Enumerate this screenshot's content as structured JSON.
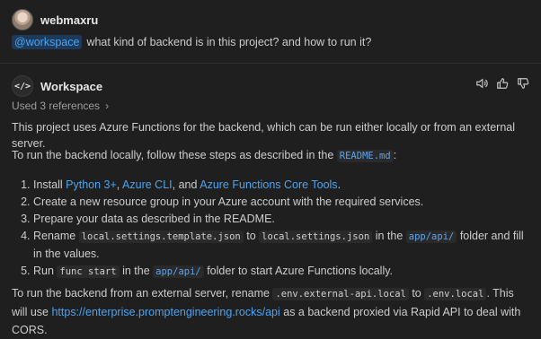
{
  "user": {
    "name": "webmaxru"
  },
  "question": {
    "mention": "@workspace",
    "text": "what kind of backend is in this project? and how to run it?"
  },
  "assistant": {
    "name": "Workspace",
    "icon": "code-brackets-icon"
  },
  "actions": {
    "speak": "speaker-icon",
    "like": "thumbs-up-icon",
    "dislike": "thumbs-down-icon"
  },
  "references": {
    "label": "Used 3 references"
  },
  "answer": {
    "intro": "This project uses Azure Functions for the backend, which can be run either locally or from an external server.",
    "local_intro_text": "To run the backend locally, follow these steps as described in the ",
    "local_intro_code": "README.md",
    "local_intro_end": ":",
    "steps": {
      "s1": {
        "pre": "Install ",
        "link1": "Python 3+",
        "sep1": ", ",
        "link2": "Azure CLI",
        "sep2": ", and ",
        "link3": "Azure Functions Core Tools",
        "end": "."
      },
      "s2": {
        "text": "Create a new resource group in your Azure account with the required services."
      },
      "s3": {
        "text": "Prepare your data as described in the README."
      },
      "s4": {
        "pre": "Rename ",
        "code1": "local.settings.template.json",
        "mid1": " to ",
        "code2": "local.settings.json",
        "mid2": " in the ",
        "code3": "app/api/",
        "end": " folder and fill in the values."
      },
      "s5": {
        "pre": "Run ",
        "code1": "func start",
        "mid1": " in the ",
        "code2": "app/api/",
        "end": " folder to start Azure Functions locally."
      }
    },
    "external": {
      "pre": "To run the backend from an external server, rename ",
      "code1": ".env.external-api.local",
      "mid1": " to ",
      "code2": ".env.local",
      "mid2": ". This will use ",
      "link": "https://enterprise.promptengineering.rocks/api",
      "end": " as a backend proxied via Rapid API to deal with CORS."
    }
  }
}
